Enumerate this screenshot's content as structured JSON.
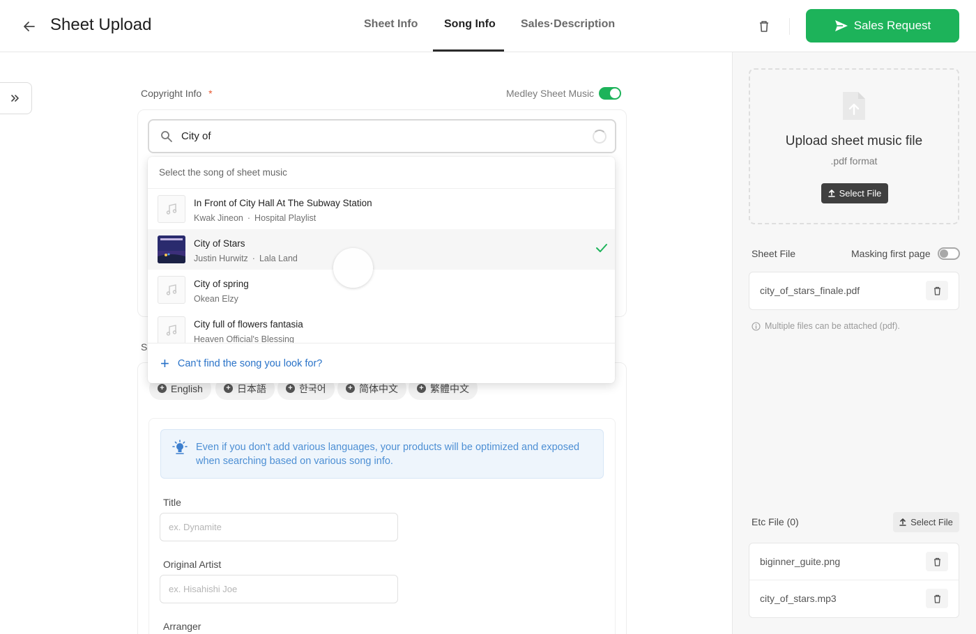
{
  "header": {
    "title": "Sheet Upload",
    "tabs": [
      {
        "label": "Sheet Info",
        "active": false
      },
      {
        "label": "Song Info",
        "active": true
      },
      {
        "label": "Sales·Description",
        "active": false
      }
    ],
    "sales_request_label": "Sales Request",
    "accent_color": "#1db35a"
  },
  "copyright": {
    "label": "Copyright Info",
    "required_mark": "*",
    "medley_label": "Medley Sheet Music",
    "medley_on": true
  },
  "search": {
    "value": "City of",
    "placeholder": ""
  },
  "dropdown": {
    "header": "Select the song of sheet music",
    "items": [
      {
        "title": "In Front of City Hall At The Subway Station",
        "artist": "Kwak Jineon",
        "album": "Hospital Playlist",
        "thumb": "music-note-icon",
        "selected": false
      },
      {
        "title": "City of Stars",
        "artist": "Justin Hurwitz",
        "album": "Lala Land",
        "thumb": "album-art",
        "selected": true
      },
      {
        "title": "City of spring",
        "artist": "Okean Elzy",
        "album": "",
        "thumb": "music-note-icon",
        "selected": false
      },
      {
        "title": "City full of flowers fantasia",
        "artist": "Heaven Official's Blessing",
        "album": "",
        "thumb": "music-note-icon",
        "selected": false
      }
    ],
    "footer": "Can't find the song you look for?"
  },
  "song_info": {
    "section_letter": "S",
    "languages": [
      "English",
      "日本語",
      "한국어",
      "简体中文",
      "繁體中文"
    ],
    "info_text": "Even if you don't add various languages, your products will be optimized and exposed when searching based on various song info.",
    "title_label": "Title",
    "title_placeholder": "ex. Dynamite",
    "artist_label": "Original Artist",
    "artist_placeholder": "ex. Hisahishi Joe",
    "arranger_label": "Arranger"
  },
  "right_panel": {
    "upload_title": "Upload sheet music file",
    "upload_sub": ".pdf format",
    "select_file_label": "Select File",
    "sheet_file_label": "Sheet File",
    "masking_label": "Masking first page",
    "masking_on": false,
    "sheet_files": [
      "city_of_stars_finale.pdf"
    ],
    "hint": "Multiple files can be attached (pdf).",
    "etc_label": "Etc File (0)",
    "etc_select_label": "Select File",
    "etc_files": [
      "biginner_guite.png",
      "city_of_stars.mp3"
    ]
  }
}
